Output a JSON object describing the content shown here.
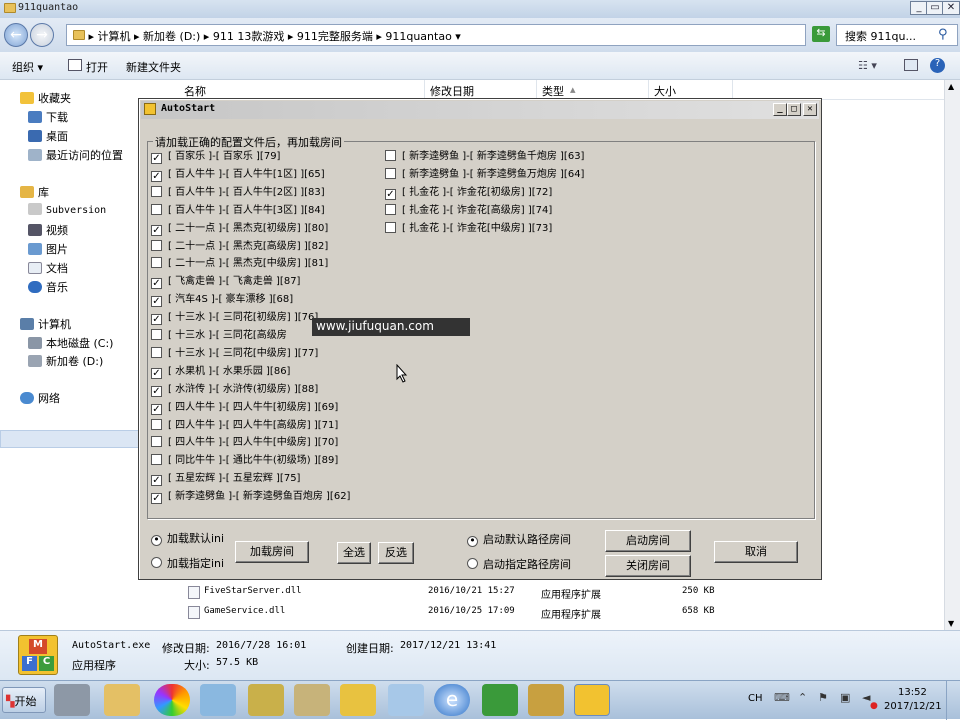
{
  "explorer": {
    "title": "911quantao",
    "address": [
      "计算机",
      "新加卷 (D:)",
      "911 13款游戏",
      "911完整服务端",
      "911quantao"
    ],
    "search_placeholder": "搜索 911qu...",
    "toolbar": {
      "organize": "组织 ▾",
      "open": "打开",
      "new_folder": "新建文件夹"
    },
    "nav": {
      "favorites": "收藏夹",
      "downloads": "下载",
      "desktop": "桌面",
      "recent": "最近访问的位置",
      "libraries": "库",
      "subversion": "Subversion",
      "videos": "视频",
      "pictures": "图片",
      "documents": "文档",
      "music": "音乐",
      "computer": "计算机",
      "local_disk": "本地磁盘 (C:)",
      "new_volume": "新加卷 (D:)",
      "network": "网络"
    },
    "columns": {
      "name": "名称",
      "modified": "修改日期",
      "type": "类型",
      "size": "大小"
    },
    "files": [
      {
        "name": "FiveStarServer.dll",
        "modified": "2016/10/21 15:27",
        "type": "应用程序扩展",
        "size": "250 KB"
      },
      {
        "name": "GameService.dll",
        "modified": "2016/10/25 17:09",
        "type": "应用程序扩展",
        "size": "658 KB"
      }
    ],
    "details": {
      "filename": "AutoStart.exe",
      "modified_label": "修改日期:",
      "modified": "2016/7/28 16:01",
      "created_label": "创建日期:",
      "created": "2017/12/21 13:41",
      "type": "应用程序",
      "size_label": "大小:",
      "size": "57.5 KB"
    }
  },
  "dialog": {
    "title": "AutoStart",
    "group_label": "请加载正确的配置文件后，再加载房间",
    "left_items": [
      {
        "label": "[ 百家乐 ]-[ 百家乐 ][79]",
        "checked": true
      },
      {
        "label": "[ 百人牛牛 ]-[ 百人牛牛[1区] ][65]",
        "checked": true
      },
      {
        "label": "[ 百人牛牛 ]-[ 百人牛牛[2区] ][83]",
        "checked": false
      },
      {
        "label": "[ 百人牛牛 ]-[ 百人牛牛[3区] ][84]",
        "checked": false
      },
      {
        "label": "[ 二十一点 ]-[ 黑杰克[初级房] ][80]",
        "checked": true
      },
      {
        "label": "[ 二十一点 ]-[ 黑杰克[高级房] ][82]",
        "checked": false
      },
      {
        "label": "[ 二十一点 ]-[ 黑杰克[中级房] ][81]",
        "checked": false
      },
      {
        "label": "[ 飞禽走兽 ]-[ 飞禽走兽 ][87]",
        "checked": true
      },
      {
        "label": "[ 汽车4S ]-[ 豪车漂移 ][68]",
        "checked": true
      },
      {
        "label": "[ 十三水 ]-[ 三同花[初级房] ][76]",
        "checked": true
      },
      {
        "label": "[ 十三水 ]-[ 三同花[高级房",
        "checked": false
      },
      {
        "label": "[ 十三水 ]-[ 三同花[中级房] ][77]",
        "checked": false
      },
      {
        "label": "[ 水果机 ]-[ 水果乐园 ][86]",
        "checked": true
      },
      {
        "label": "[ 水浒传 ]-[ 水浒传(初级房) ][88]",
        "checked": true
      },
      {
        "label": "[ 四人牛牛 ]-[ 四人牛牛[初级房] ][69]",
        "checked": true
      },
      {
        "label": "[ 四人牛牛 ]-[ 四人牛牛[高级房] ][71]",
        "checked": false
      },
      {
        "label": "[ 四人牛牛 ]-[ 四人牛牛[中级房] ][70]",
        "checked": false
      },
      {
        "label": "[ 同比牛牛 ]-[ 通比牛牛(初级场) ][89]",
        "checked": false
      },
      {
        "label": "[ 五星宏辉 ]-[ 五星宏辉 ][75]",
        "checked": true
      },
      {
        "label": "[ 新李逵劈鱼 ]-[ 新李逵劈鱼百炮房 ][62]",
        "checked": true
      }
    ],
    "right_items": [
      {
        "label": "[ 新李逵劈鱼 ]-[ 新李逵劈鱼千炮房 ][63]",
        "checked": false
      },
      {
        "label": "[ 新李逵劈鱼 ]-[ 新李逵劈鱼万炮房 ][64]",
        "checked": false
      },
      {
        "label": "[ 扎金花 ]-[ 诈金花[初级房] ][72]",
        "checked": true
      },
      {
        "label": "[ 扎金花 ]-[ 诈金花[高级房] ][74]",
        "checked": false
      },
      {
        "label": "[ 扎金花 ]-[ 诈金花[中级房] ][73]",
        "checked": false
      }
    ],
    "radio_load_default": "加载默认ini",
    "radio_load_specified": "加载指定ini",
    "btn_load_room": "加载房间",
    "btn_select_all": "全选",
    "btn_invert": "反选",
    "radio_default_path": "启动默认路径房间",
    "radio_specified_path": "启动指定路径房间",
    "btn_start_room": "启动房间",
    "btn_close_room": "关闭房间",
    "btn_cancel": "取消"
  },
  "watermark": "www.jiufuquan.com",
  "taskbar": {
    "start": "开始",
    "lang": "CH",
    "time": "13:52",
    "date": "2017/12/21"
  }
}
